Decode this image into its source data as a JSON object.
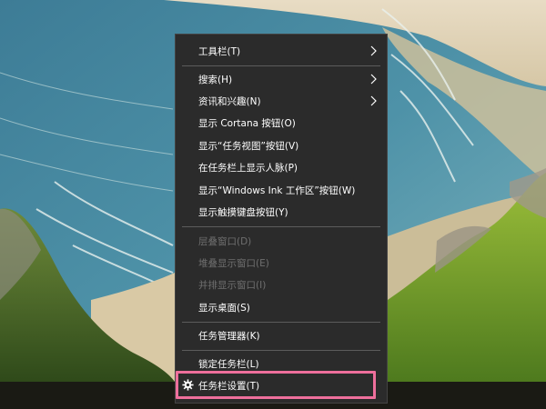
{
  "menu": {
    "items": [
      {
        "label": "工具栏(T)",
        "submenu": true,
        "enabled": true
      },
      {
        "label": "搜索(H)",
        "submenu": true,
        "enabled": true
      },
      {
        "label": "资讯和兴趣(N)",
        "submenu": true,
        "enabled": true
      },
      {
        "label": "显示 Cortana 按钮(O)",
        "submenu": false,
        "enabled": true
      },
      {
        "label": "显示“任务视图”按钮(V)",
        "submenu": false,
        "enabled": true
      },
      {
        "label": "在任务栏上显示人脉(P)",
        "submenu": false,
        "enabled": true
      },
      {
        "label": "显示“Windows Ink 工作区”按钮(W)",
        "submenu": false,
        "enabled": true
      },
      {
        "label": "显示触摸键盘按钮(Y)",
        "submenu": false,
        "enabled": true
      },
      {
        "label": "层叠窗口(D)",
        "submenu": false,
        "enabled": false
      },
      {
        "label": "堆叠显示窗口(E)",
        "submenu": false,
        "enabled": false
      },
      {
        "label": "并排显示窗口(I)",
        "submenu": false,
        "enabled": false
      },
      {
        "label": "显示桌面(S)",
        "submenu": false,
        "enabled": true
      },
      {
        "label": "任务管理器(K)",
        "submenu": false,
        "enabled": true
      },
      {
        "label": "锁定任务栏(L)",
        "submenu": false,
        "enabled": true
      },
      {
        "label": "任务栏设置(T)",
        "submenu": false,
        "enabled": true,
        "icon": "gear-icon"
      }
    ]
  },
  "colors": {
    "menu_background": "#2b2b2b",
    "menu_text": "#ffffff",
    "disabled_text": "#6f6f6f",
    "separator": "#5c5c5c",
    "highlight_border": "#ee6f9c"
  }
}
